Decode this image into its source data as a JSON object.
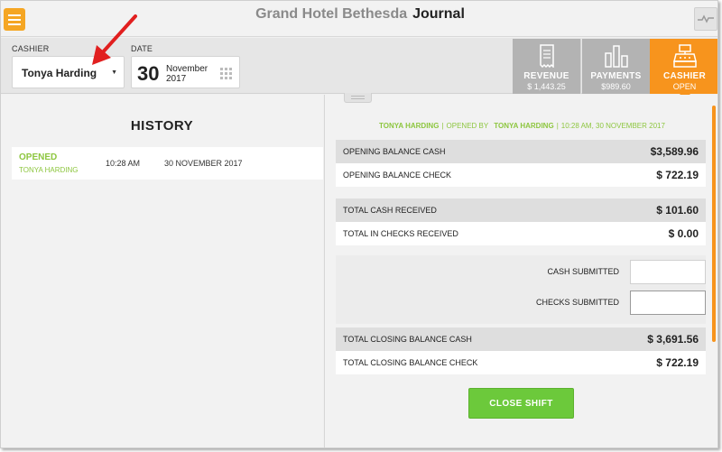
{
  "header": {
    "hotel_name": "Grand Hotel Bethesda",
    "page_title": "Journal",
    "menu_icon": "hamburger-menu-icon",
    "activity_icon": "pulse-line-icon"
  },
  "controls": {
    "cashier_label": "CASHIER",
    "cashier_value": "Tonya Harding",
    "date_label": "DATE",
    "date_day": "30",
    "date_month": "November",
    "date_year": "2017"
  },
  "tabs": [
    {
      "label": "REVENUE",
      "sub": "$ 1,443.25",
      "icon": "receipt-icon"
    },
    {
      "label": "PAYMENTS",
      "sub": "$989.60",
      "icon": "bar-chart-icon"
    },
    {
      "label": "CASHIER",
      "sub": "OPEN",
      "icon": "cash-register-icon"
    }
  ],
  "history": {
    "title": "HISTORY",
    "entries": [
      {
        "status": "OPENED",
        "name": "TONYA HARDING",
        "time": "10:28 AM",
        "date": "30 NOVEMBER 2017"
      }
    ]
  },
  "shift": {
    "cashier_name": "TONYA HARDING",
    "opened_by_label": "OPENED BY",
    "opened_by_name": "TONYA HARDING",
    "opened_at": "10:28 AM, 30 NOVEMBER 2017",
    "rows": [
      {
        "label": "OPENING BALANCE CASH",
        "amount": "$3,589.96"
      },
      {
        "label": "OPENING BALANCE CHECK",
        "amount": "$ 722.19"
      },
      {
        "label": "TOTAL CASH RECEIVED",
        "amount": "$ 101.60"
      },
      {
        "label": "TOTAL IN CHECKS RECEIVED",
        "amount": "$ 0.00"
      },
      {
        "label": "TOTAL CLOSING BALANCE CASH",
        "amount": "$ 3,691.56"
      },
      {
        "label": "TOTAL CLOSING BALANCE CHECK",
        "amount": "$ 722.19"
      }
    ],
    "cash_submitted_label": "CASH SUBMITTED",
    "cash_submitted_value": "",
    "checks_submitted_label": "CHECKS SUBMITTED",
    "checks_submitted_value": "",
    "close_button": "CLOSE SHIFT"
  },
  "colors": {
    "accent_orange": "#f7941d",
    "menu_orange": "#f5a623",
    "green": "#8dc63f",
    "button_green": "#6cc93b",
    "tab_gray": "#b3b3b3",
    "annotation_red": "#e11f1f"
  }
}
